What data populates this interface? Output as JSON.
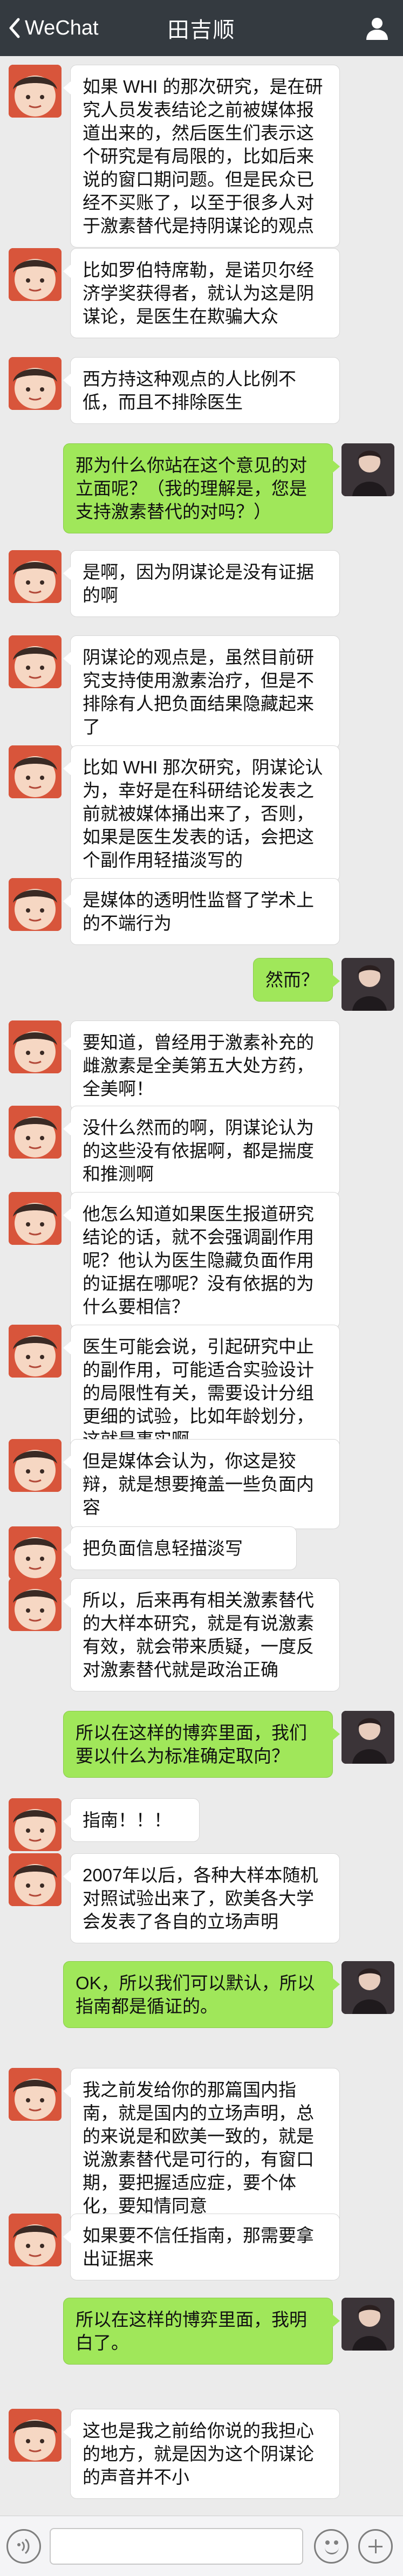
{
  "nav": {
    "back_label": "WeChat",
    "title": "田吉顺"
  },
  "colors": {
    "nav_bg": "#343a40",
    "chat_bg": "#ebebeb",
    "bubble_received": "#ffffff",
    "bubble_sent": "#a0e75a"
  },
  "messages": [
    {
      "side": "left",
      "text": "如果 WHI 的那次研究，是在研究人员发表结论之前被媒体报道出来的，然后医生们表示这个研究是有局限的，比如后来说的窗口期问题。但是民众已经不买账了，以至于很多人对于激素替代是持阴谋论的观点"
    },
    {
      "side": "left",
      "text": "比如罗伯特席勒，是诺贝尔经济学奖获得者，就认为这是阴谋论，是医生在欺骗大众"
    },
    {
      "side": "left",
      "text": "西方持这种观点的人比例不低，而且不排除医生"
    },
    {
      "side": "right",
      "text": "那为什么你站在这个意见的对立面呢？（我的理解是，您是支持激素替代的对吗？）"
    },
    {
      "side": "left",
      "text": "是啊，因为阴谋论是没有证据的啊"
    },
    {
      "side": "left",
      "text": "阴谋论的观点是，虽然目前研究支持使用激素治疗，但是不排除有人把负面结果隐藏起来了"
    },
    {
      "side": "left",
      "text": "比如 WHI 那次研究，阴谋论认为，幸好是在科研结论发表之前就被媒体捅出来了，否则，如果是医生发表的话，会把这个副作用轻描淡写的"
    },
    {
      "side": "left",
      "text": "是媒体的透明性监督了学术上的不端行为"
    },
    {
      "side": "right",
      "text": "然而？"
    },
    {
      "side": "left",
      "text": "要知道，曾经用于激素补充的雌激素是全美第五大处方药，全美啊！"
    },
    {
      "side": "left",
      "text": "没什么然而的啊，阴谋论认为的这些没有依据啊，都是揣度和推测啊"
    },
    {
      "side": "left",
      "text": "他怎么知道如果医生报道研究结论的话，就不会强调副作用呢？他认为医生隐藏负面作用的证据在哪呢？没有依据的为什么要相信？"
    },
    {
      "side": "left",
      "text": "医生可能会说，引起研究中止的副作用，可能适合实验设计的局限性有关，需要设计分组更细的试验，比如年龄划分，这就是事实啊"
    },
    {
      "side": "left",
      "text": "但是媒体会认为，你这是狡辩，就是想要掩盖一些负面内容"
    },
    {
      "side": "left",
      "text": "把负面信息轻描淡写"
    },
    {
      "side": "left",
      "text": "所以，后来再有相关激素替代的大样本研究，就是有说激素有效，就会带来质疑，一度反对激素替代就是政治正确"
    },
    {
      "side": "right",
      "text": "所以在这样的博弈里面，我们要以什么为标准确定取向？"
    },
    {
      "side": "left",
      "text": "指南！！！"
    },
    {
      "side": "left",
      "text": "2007年以后，各种大样本随机对照试验出来了，欧美各大学会发表了各自的立场声明"
    },
    {
      "side": "right",
      "text": "OK，所以我们可以默认，所以指南都是循证的。"
    },
    {
      "side": "left",
      "text": "我之前发给你的那篇国内指南，就是国内的立场声明，总的来说是和欧美一致的，就是说激素替代是可行的，有窗口期，要把握适应症，要个体化，要知情同意"
    },
    {
      "side": "left",
      "text": "如果要不信任指南，那需要拿出证据来"
    },
    {
      "side": "right",
      "text": "所以在这样的博弈里面，我明白了。"
    },
    {
      "side": "left",
      "text": "这也是我之前给你说的我担心的地方，就是因为这个阴谋论的声音并不小"
    }
  ]
}
